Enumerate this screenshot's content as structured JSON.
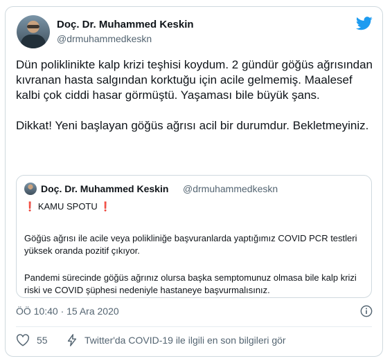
{
  "author": {
    "name": "Doç. Dr. Muhammed Keskin",
    "handle": "@drmuhammedkeskn"
  },
  "tweet": {
    "text": "Dün poliklinikte kalp krizi teşhisi koydum. 2 gündür göğüs ağrısından kıvranan hasta salgından korktuğu için acile gelmemiş. Maalesef kalbi çok ciddi hasar görmüştü. Yaşaması bile büyük şans.\n\nDikkat! Yeni başlayan göğüs ağrısı acil bir durumdur. Bekletmeyiniz."
  },
  "quote": {
    "name": "Doç. Dr. Muhammed Keskin",
    "handle": "@drmuhammedkeskn",
    "spot_prefix": "❗",
    "spot_label": "KAMU SPOTU",
    "spot_suffix": "❗",
    "paragraph1": "Göğüs ağrısı ile acile veya polikliniğe başvuranlarda yaptığımız COVID PCR testleri yüksek oranda pozitif çıkıyor.",
    "paragraph2": "Pandemi sürecinde göğüs ağrınız olursa başka semptomunuz olmasa bile kalp krizi riski ve COVID şüphesi nedeniyle hastaneye başvurmalısınız."
  },
  "meta": {
    "timestamp": "ÖÖ 10:40 · 15 Ara 2020"
  },
  "actions": {
    "likes": "55",
    "covid_link": "Twitter'da COVID-19 ile ilgili en son bilgileri gör"
  },
  "colors": {
    "twitter_blue": "#1d9bf0",
    "secondary_text": "#536471",
    "warning_red": "#d62a2a"
  }
}
